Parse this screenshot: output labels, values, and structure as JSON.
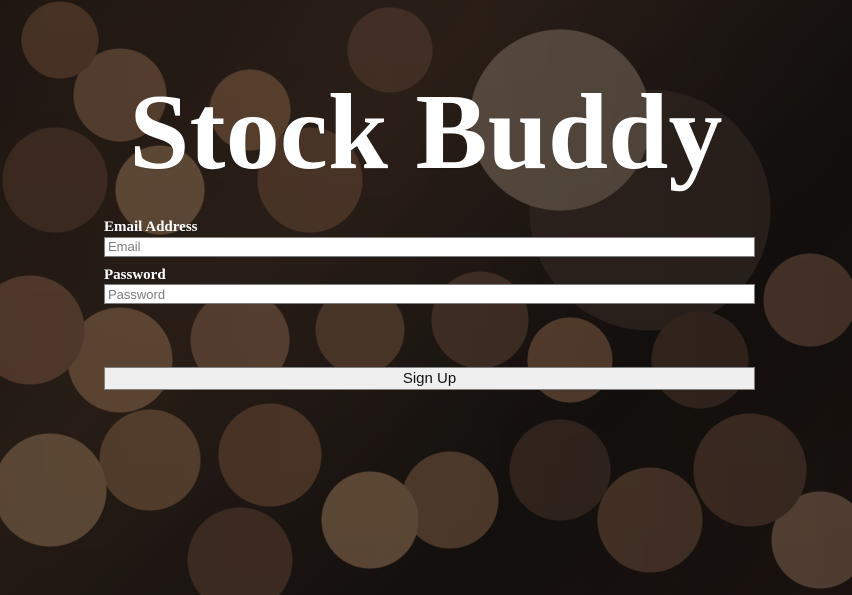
{
  "app": {
    "title": "Stock Buddy"
  },
  "form": {
    "email_label": "Email Address",
    "email_placeholder": "Email",
    "password_label": "Password",
    "password_placeholder": "Password",
    "submit_label": "Sign Up"
  },
  "background": {
    "image_subject": "coins"
  },
  "colors": {
    "title": "#ffffff",
    "input_background": "#ffffff",
    "button_background": "#efefef"
  }
}
